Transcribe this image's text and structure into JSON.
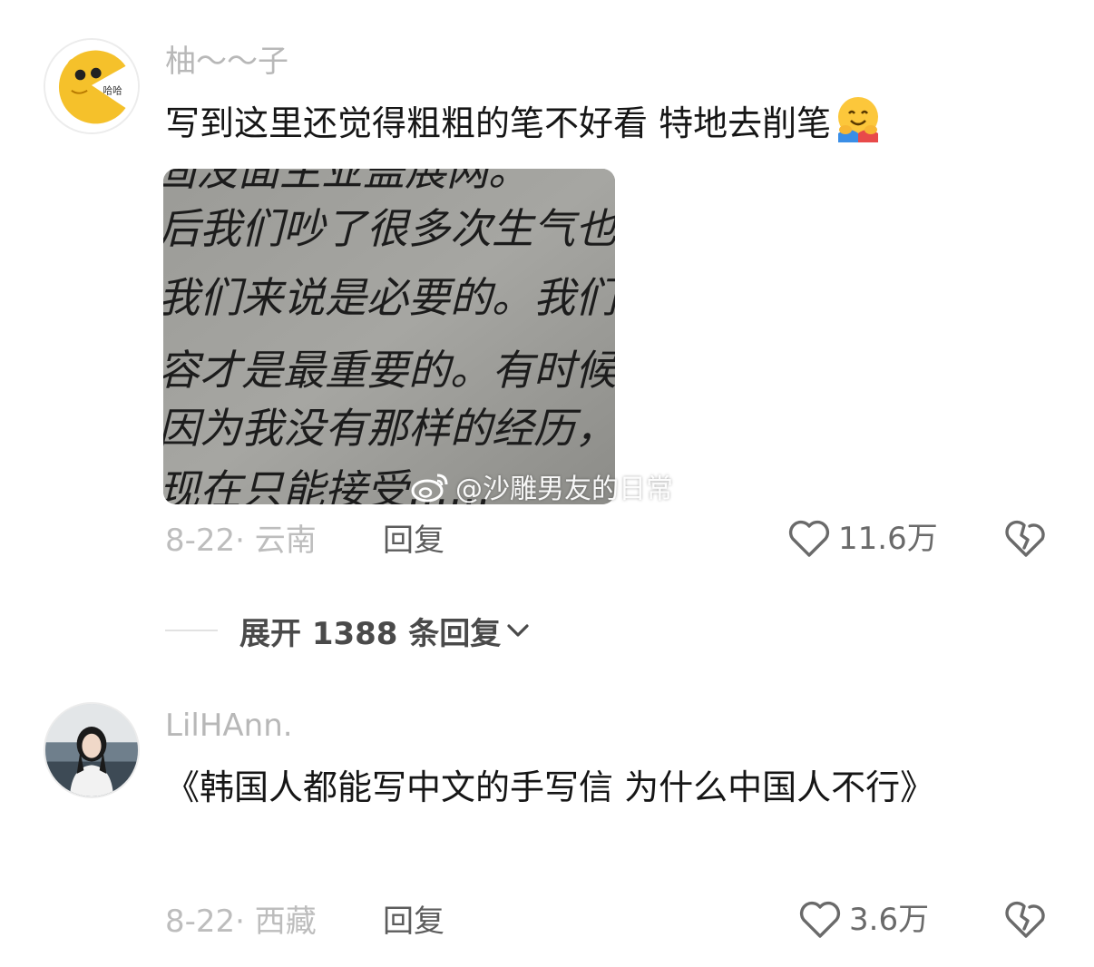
{
  "comments": [
    {
      "username": "柚～～子",
      "text": "写到这里还觉得粗粗的笔不好看 特地去削笔",
      "emoji_icon": "hugging-face-emoji",
      "image": {
        "handwriting_lines": [
          "固没面主业盖展网。",
          "后我们吵了很多次生气也哭了",
          "我们来说是必要的。我们不可",
          "容才是最重要的。有时候想到",
          "因为我没有那样的经历，",
          "现在只能接受……"
        ],
        "watermark": "@沙雕男友的日常",
        "watermark_icon": "weibo-icon"
      },
      "date_location": "8-22· 云南",
      "reply_label": "回复",
      "likes": "11.6万"
    },
    {
      "username": "LilHAnn.",
      "text": "《韩国人都能写中文的手写信 为什么中国人不行》",
      "date_location": "8-22· 西藏",
      "reply_label": "回复",
      "likes": "3.6万"
    }
  ],
  "expand_replies": {
    "label": "展开 1388 条回复"
  },
  "avatar_badge_text": "哈哈",
  "colors": {
    "username": "#b8b8b8",
    "text": "#161616",
    "meta": "#bdbdbd",
    "avatar_yellow": "#f5c12b"
  }
}
